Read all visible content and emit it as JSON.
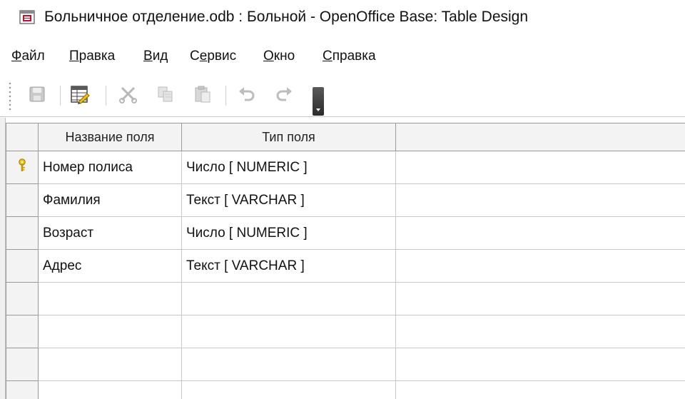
{
  "window": {
    "title": "Больничное отделение.odb : Больной - OpenOffice Base: Table Design",
    "icon": "database-document-icon"
  },
  "menu": [
    {
      "mnemonic": "Ф",
      "rest": "айл"
    },
    {
      "mnemonic": "П",
      "rest": "равка"
    },
    {
      "mnemonic": "В",
      "rest": "ид"
    },
    {
      "mnemonic": "С",
      "rest": "ервис",
      "pre": ""
    },
    {
      "mnemonic": "О",
      "rest": "кно"
    },
    {
      "mnemonic": "С",
      "rest": "правка"
    }
  ],
  "toolbar": {
    "buttons": [
      "save-icon",
      "edit-table-icon",
      "cut-icon",
      "copy-icon",
      "paste-icon",
      "undo-icon",
      "redo-icon"
    ],
    "accent": "#e8b800"
  },
  "table": {
    "columns": [
      "Название поля",
      "Тип поля",
      ""
    ],
    "rows": [
      {
        "field": "Номер полиса",
        "type": "Число [ NUMERIC ]",
        "primary_key": true
      },
      {
        "field": "Фамилия",
        "type": "Текст [ VARCHAR ]",
        "primary_key": false
      },
      {
        "field": "Возраст",
        "type": "Число [ NUMERIC ]",
        "primary_key": false
      },
      {
        "field": "Адрес",
        "type": "Текст [ VARCHAR ]",
        "primary_key": false
      },
      {
        "field": "",
        "type": "",
        "primary_key": false
      },
      {
        "field": "",
        "type": "",
        "primary_key": false
      },
      {
        "field": "",
        "type": "",
        "primary_key": false
      },
      {
        "field": "",
        "type": "",
        "primary_key": false
      }
    ]
  }
}
